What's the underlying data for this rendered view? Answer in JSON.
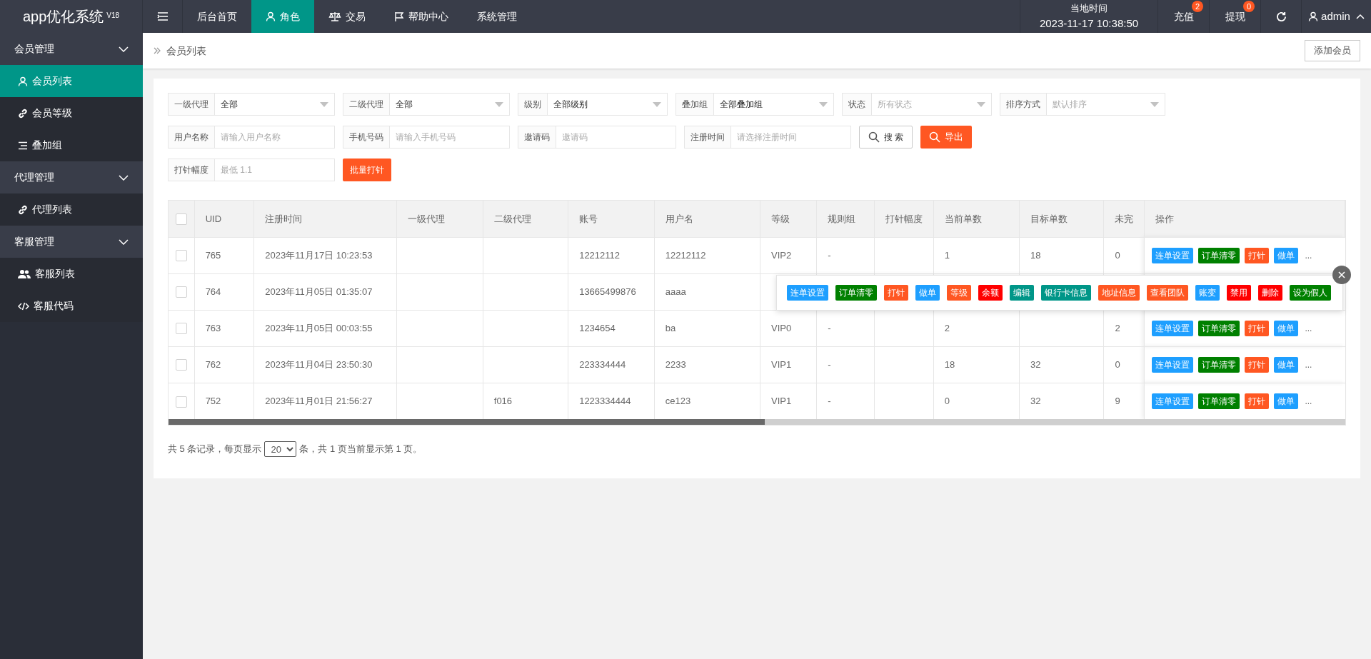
{
  "logo": {
    "title": "app优化系统",
    "version": "V18"
  },
  "top_nav": [
    {
      "label": "后台首页",
      "selected": false
    },
    {
      "label": "角色",
      "selected": true
    },
    {
      "label": "交易",
      "selected": false
    },
    {
      "label": "帮助中心",
      "selected": false
    },
    {
      "label": "系统管理",
      "selected": false
    }
  ],
  "clock": {
    "label": "当地时间",
    "time": "2023-11-17 10:38:50"
  },
  "top_right": [
    {
      "label": "充值",
      "badge": "2"
    },
    {
      "label": "提现",
      "badge": "0"
    }
  ],
  "user": {
    "name": "admin"
  },
  "sidebar": [
    {
      "label": "会员管理",
      "expanded": true,
      "children": [
        {
          "label": "会员列表",
          "selected": true
        },
        {
          "label": "会员等级",
          "selected": false
        },
        {
          "label": "叠加组",
          "selected": false
        }
      ]
    },
    {
      "label": "代理管理",
      "expanded": true,
      "children": [
        {
          "label": "代理列表",
          "selected": false
        }
      ]
    },
    {
      "label": "客服管理",
      "expanded": true,
      "children": [
        {
          "label": "客服列表",
          "selected": false
        },
        {
          "label": "客服代码",
          "selected": false
        }
      ]
    }
  ],
  "breadcrumb": "会员列表",
  "add_button": "添加会员",
  "filters": [
    [
      {
        "kind": "select",
        "label": "一级代理",
        "value": "全部"
      },
      {
        "kind": "select",
        "label": "二级代理",
        "value": "全部"
      },
      {
        "kind": "select",
        "label": "级别",
        "value": "全部级别"
      },
      {
        "kind": "select",
        "label": "叠加组",
        "value": "全部叠加组"
      },
      {
        "kind": "select",
        "label": "状态",
        "placeholder": "所有状态"
      },
      {
        "kind": "select",
        "label": "排序方式",
        "placeholder": "默认排序"
      }
    ],
    [
      {
        "kind": "input",
        "label": "用户名称",
        "placeholder": "请输入用户名称"
      },
      {
        "kind": "input",
        "label": "手机号码",
        "placeholder": "请输入手机号码"
      },
      {
        "kind": "input",
        "label": "邀请码",
        "placeholder": "邀请码"
      },
      {
        "kind": "input",
        "label": "注册时间",
        "placeholder": "请选择注册时间"
      },
      {
        "kind": "search",
        "label": "搜 索"
      },
      {
        "kind": "export",
        "label": "导出"
      }
    ],
    [
      {
        "kind": "input",
        "label": "打针幅度",
        "placeholder": "最低 1.1"
      },
      {
        "kind": "batch",
        "label": "批量打针"
      }
    ]
  ],
  "table": {
    "header_checked": false,
    "columns": [
      "UID",
      "注册时间",
      "一级代理",
      "二级代理",
      "账号",
      "用户名",
      "等级",
      "规则组",
      "打针幅度",
      "当前单数",
      "目标单数",
      "未完",
      "操作"
    ],
    "rows": [
      {
        "checked": false,
        "cells": [
          "765",
          "2023年11月17日 10:23:53",
          "",
          "",
          "12212112",
          "12212112",
          "VIP2",
          "-",
          "",
          "1",
          "18",
          "0"
        ],
        "actions": {
          "buttons": [
            {
              "label": "连单设置",
              "color": "#1e9fff"
            },
            {
              "label": "订单清零",
              "color": "#008000"
            },
            {
              "label": "打针",
              "color": "#ff5722"
            },
            {
              "label": "做单",
              "color": "#1e9fff"
            }
          ],
          "more": "..."
        }
      },
      {
        "checked": false,
        "cells": [
          "764",
          "2023年11月05日 01:35:07",
          "",
          "",
          "13665499876",
          "aaaa"
        ]
      },
      {
        "checked": false,
        "cells": [
          "763",
          "2023年11月05日 00:03:55",
          "",
          "",
          "1234654",
          "ba",
          "VIP0",
          "-",
          "",
          "2",
          "",
          "2"
        ],
        "actions": {
          "buttons": [
            {
              "label": "连单设置",
              "color": "#1e9fff"
            },
            {
              "label": "订单清零",
              "color": "#008000"
            },
            {
              "label": "打针",
              "color": "#ff5722"
            },
            {
              "label": "做单",
              "color": "#1e9fff"
            }
          ],
          "more": "..."
        }
      },
      {
        "checked": false,
        "cells": [
          "762",
          "2023年11月04日 23:50:30",
          "",
          "",
          "223334444",
          "2233",
          "VIP1",
          "-",
          "",
          "18",
          "32",
          "0"
        ],
        "actions": {
          "buttons": [
            {
              "label": "连单设置",
              "color": "#1e9fff"
            },
            {
              "label": "订单清零",
              "color": "#008000"
            },
            {
              "label": "打针",
              "color": "#ff5722"
            },
            {
              "label": "做单",
              "color": "#1e9fff"
            }
          ],
          "more": "..."
        }
      },
      {
        "checked": false,
        "cells": [
          "752",
          "2023年11月01日 21:56:27",
          "",
          "f016",
          "1223334444",
          "ce123",
          "VIP1",
          "-",
          "",
          "0",
          "32",
          "9"
        ],
        "actions": {
          "buttons": [
            {
              "label": "连单设置",
              "color": "#1e9fff"
            },
            {
              "label": "订单清零",
              "color": "#008000"
            },
            {
              "label": "打针",
              "color": "#ff5722"
            },
            {
              "label": "做单",
              "color": "#1e9fff"
            }
          ],
          "more": "..."
        }
      }
    ]
  },
  "popup": {
    "actions": [
      {
        "label": "连单设置",
        "color": "#1e9fff"
      },
      {
        "label": "订单清零",
        "color": "#008000"
      },
      {
        "label": "打针",
        "color": "#ff5722"
      },
      {
        "label": "做单",
        "color": "#1e9fff"
      },
      {
        "label": "等级",
        "color": "#ff5722"
      },
      {
        "label": "余额",
        "color": "#ff0000"
      },
      {
        "label": "编辑",
        "color": "#009688"
      },
      {
        "label": "银行卡信息",
        "color": "#009688"
      },
      {
        "label": "地址信息",
        "color": "#ff5722"
      },
      {
        "label": "查看团队",
        "color": "#ff5722"
      },
      {
        "label": "账变",
        "color": "#1e9fff"
      },
      {
        "label": "禁用",
        "color": "#ff0000"
      },
      {
        "label": "删除",
        "color": "#ff0000"
      },
      {
        "label": "设为假人",
        "color": "#008000"
      }
    ]
  },
  "pagination": {
    "before": "共 5 条记录，每页显示",
    "page_size": "20",
    "after": "条，共 1 页当前显示第 1 页。"
  }
}
